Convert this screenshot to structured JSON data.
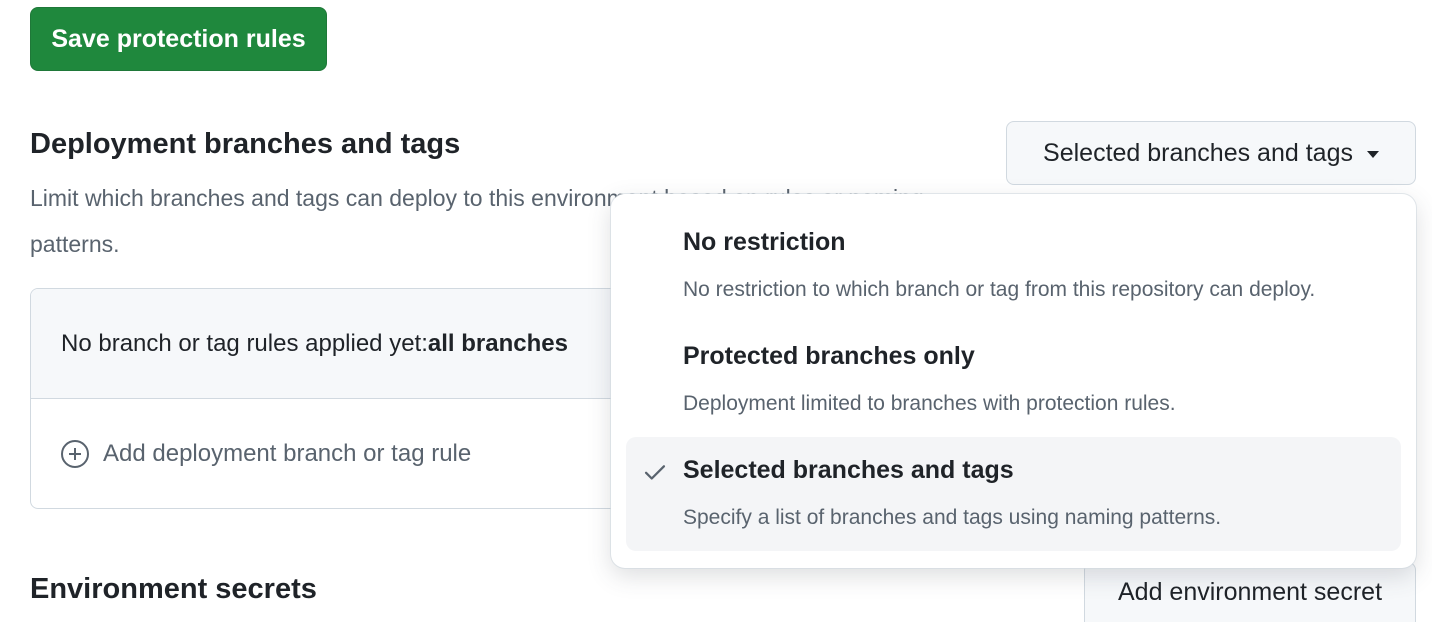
{
  "save_button": {
    "label": "Save protection rules"
  },
  "deployment_section": {
    "title": "Deployment branches and tags",
    "description": "Limit which branches and tags can deploy to this environment based on rules or naming patterns."
  },
  "branch_select": {
    "selected_label": "Selected branches and tags",
    "icon": "chevron-down-icon"
  },
  "rules_panel": {
    "empty_text_prefix": "No branch or tag rules applied yet: ",
    "empty_text_bold": "all branches",
    "add_rule_label": "Add deployment branch or tag rule",
    "add_icon": "plus-circle-icon"
  },
  "dropdown_menu": {
    "options": [
      {
        "label": "No restriction",
        "description": "No restriction to which branch or tag from this repository can deploy.",
        "selected": false
      },
      {
        "label": "Protected branches only",
        "description": "Deployment limited to branches with protection rules.",
        "selected": false
      },
      {
        "label": "Selected branches and tags",
        "description": "Specify a list of branches and tags using naming patterns.",
        "selected": true
      }
    ],
    "check_icon": "check-icon"
  },
  "environment_secrets": {
    "title": "Environment secrets",
    "add_button_label": "Add environment secret"
  },
  "colors": {
    "primary_button": "#1f883d",
    "muted_text": "#59636e",
    "border": "#d1d9e0",
    "selected_option_bg": "#f4f5f7"
  }
}
